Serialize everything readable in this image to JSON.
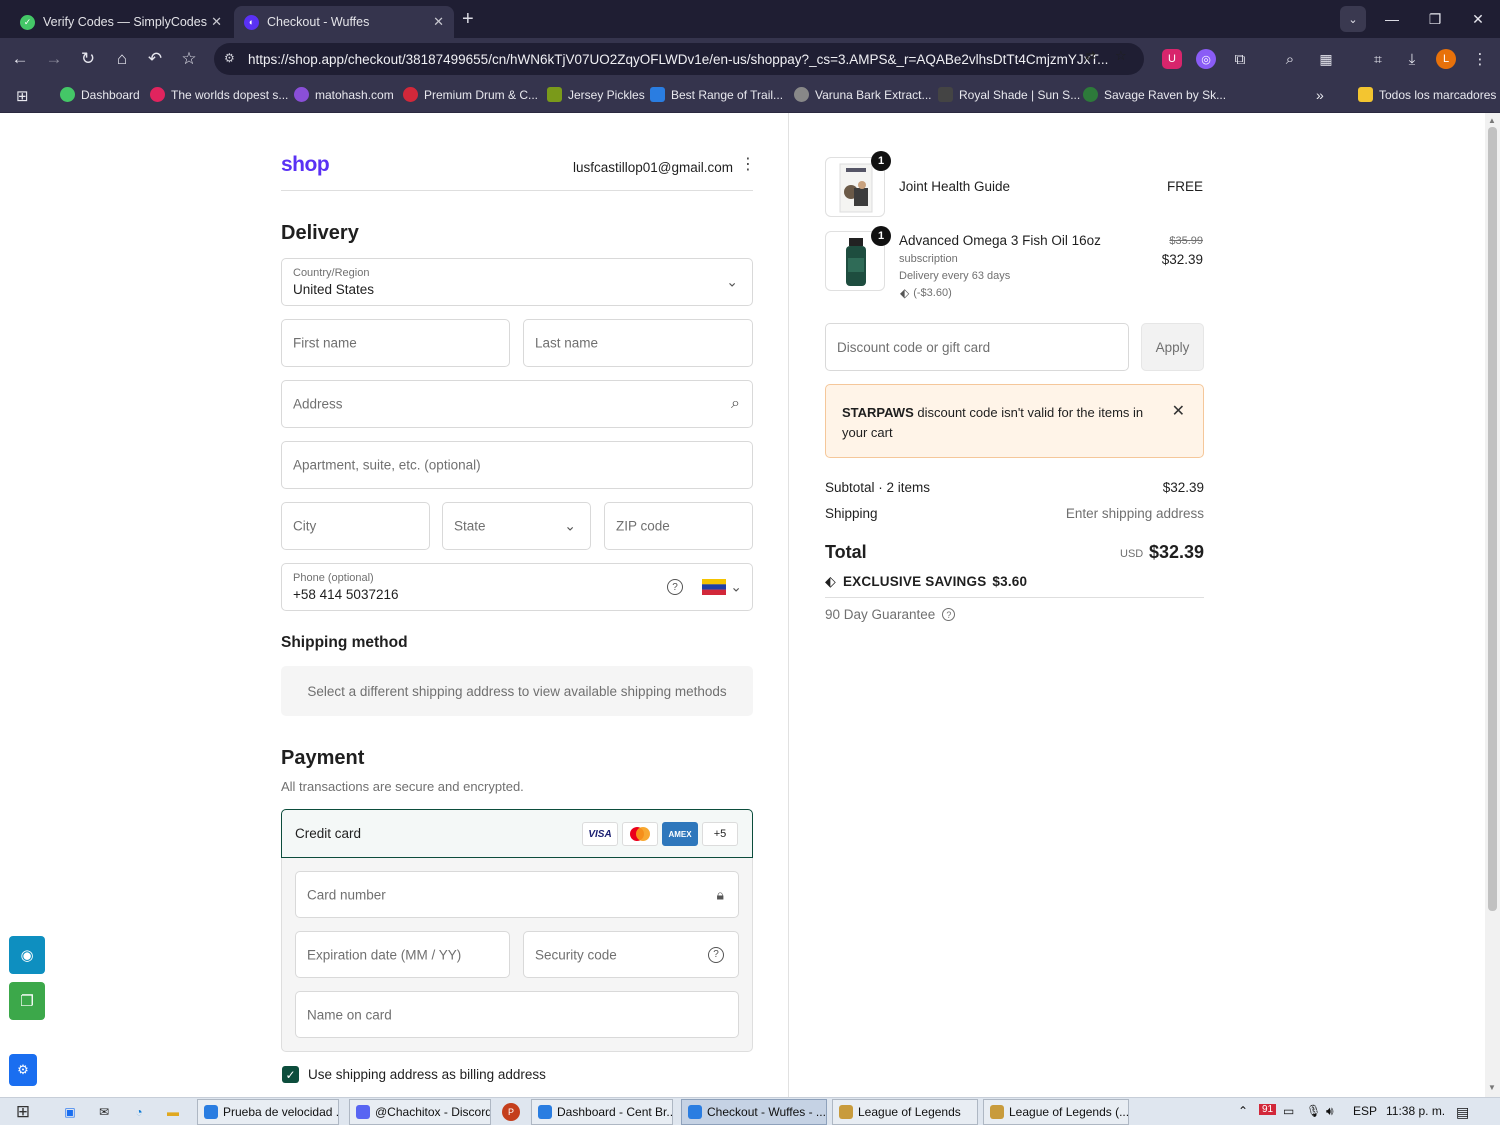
{
  "browser": {
    "tabs": [
      {
        "title": "Verify Codes — SimplyCodes",
        "active": false,
        "icon": "simplycodes-icon"
      },
      {
        "title": "Checkout - Wuffes",
        "active": true,
        "icon": "shop-icon"
      }
    ],
    "url": "https://shop.app/checkout/38187499655/cn/hWN6kTjV07UO2ZqyOFLWDv1e/en-us/shoppay?_cs=3.AMPS&_r=AQABe2vlhsDtTt4CmjzmYJxT...",
    "profile_initial": "L",
    "bookmarks": [
      {
        "label": "Dashboard",
        "color": "#44c767"
      },
      {
        "label": "The worlds dopest s...",
        "color": "#e0245e"
      },
      {
        "label": "matohash.com",
        "color": "#8a4fd8"
      },
      {
        "label": "Premium Drum & C...",
        "color": "#d2283a"
      },
      {
        "label": "Jersey Pickles",
        "color": "#7a9a1a"
      },
      {
        "label": "Best Range of Trail...",
        "color": "#2a7de1"
      },
      {
        "label": "Varuna Bark Extract...",
        "color": "#888888"
      },
      {
        "label": "Royal Shade | Sun S...",
        "color": "#444444"
      },
      {
        "label": "Savage Raven by Sk...",
        "color": "#2d7a3a"
      }
    ],
    "bookmarks_folder": "Todos los marcadores"
  },
  "checkout": {
    "logo": "shop",
    "email": "lusfcastillop01@gmail.com",
    "delivery_heading": "Delivery",
    "country": {
      "label": "Country/Region",
      "value": "United States"
    },
    "first_name_placeholder": "First name",
    "last_name_placeholder": "Last name",
    "address_placeholder": "Address",
    "apartment_placeholder": "Apartment, suite, etc. (optional)",
    "city_placeholder": "City",
    "state_placeholder": "State",
    "zip_placeholder": "ZIP code",
    "phone": {
      "label": "Phone (optional)",
      "value": "+58 414 5037216"
    },
    "shipping_method_heading": "Shipping method",
    "shipping_method_note": "Select a different shipping address to view available shipping methods",
    "payment_heading": "Payment",
    "payment_subtitle": "All transactions are secure and encrypted.",
    "credit_card_label": "Credit card",
    "card_brands": [
      "VISA",
      "Mastercard",
      "AMEX",
      "+5"
    ],
    "card_number_placeholder": "Card number",
    "expiration_placeholder": "Expiration date (MM / YY)",
    "security_code_placeholder": "Security code",
    "name_on_card_placeholder": "Name on card",
    "billing_checkbox_label": "Use shipping address as billing address",
    "billing_checked": true
  },
  "summary": {
    "items": [
      {
        "qty": "1",
        "name": "Joint Health Guide",
        "price": "FREE"
      },
      {
        "qty": "1",
        "name": "Advanced Omega 3 Fish Oil 16oz",
        "subtitle": "subscription",
        "delivery": "Delivery every 63 days",
        "discount": "(-$3.60)",
        "original_price": "$35.99",
        "price": "$32.39"
      }
    ],
    "discount_placeholder": "Discount code or gift card",
    "apply_label": "Apply",
    "alert": {
      "code": "STARPAWS",
      "message": " discount code isn't valid for the items in your cart"
    },
    "subtotal_label": "Subtotal · 2 items",
    "subtotal_value": "$32.39",
    "shipping_label": "Shipping",
    "shipping_value": "Enter shipping address",
    "total_label": "Total",
    "currency": "USD",
    "total_value": "$32.39",
    "savings_label": "EXCLUSIVE SAVINGS",
    "savings_value": "$3.60",
    "guarantee": "90 Day Guarantee"
  },
  "taskbar": {
    "apps": [
      {
        "label": "Prueba de velocidad ...",
        "active": false,
        "color": "#2a7de1"
      },
      {
        "label": "@Chachitox - Discord",
        "active": false,
        "color": "#5865f2"
      },
      {
        "label": "Dashboard - Cent Br...",
        "active": false,
        "color": "#2a7de1"
      },
      {
        "label": "Checkout - Wuffes - ...",
        "active": true,
        "color": "#2a7de1"
      },
      {
        "label": "League of Legends",
        "active": false,
        "color": "#c89b3c"
      },
      {
        "label": "League of Legends (...",
        "active": false,
        "color": "#c89b3c"
      }
    ],
    "badge": "91",
    "language": "ESP",
    "time": "11:38 p. m."
  }
}
